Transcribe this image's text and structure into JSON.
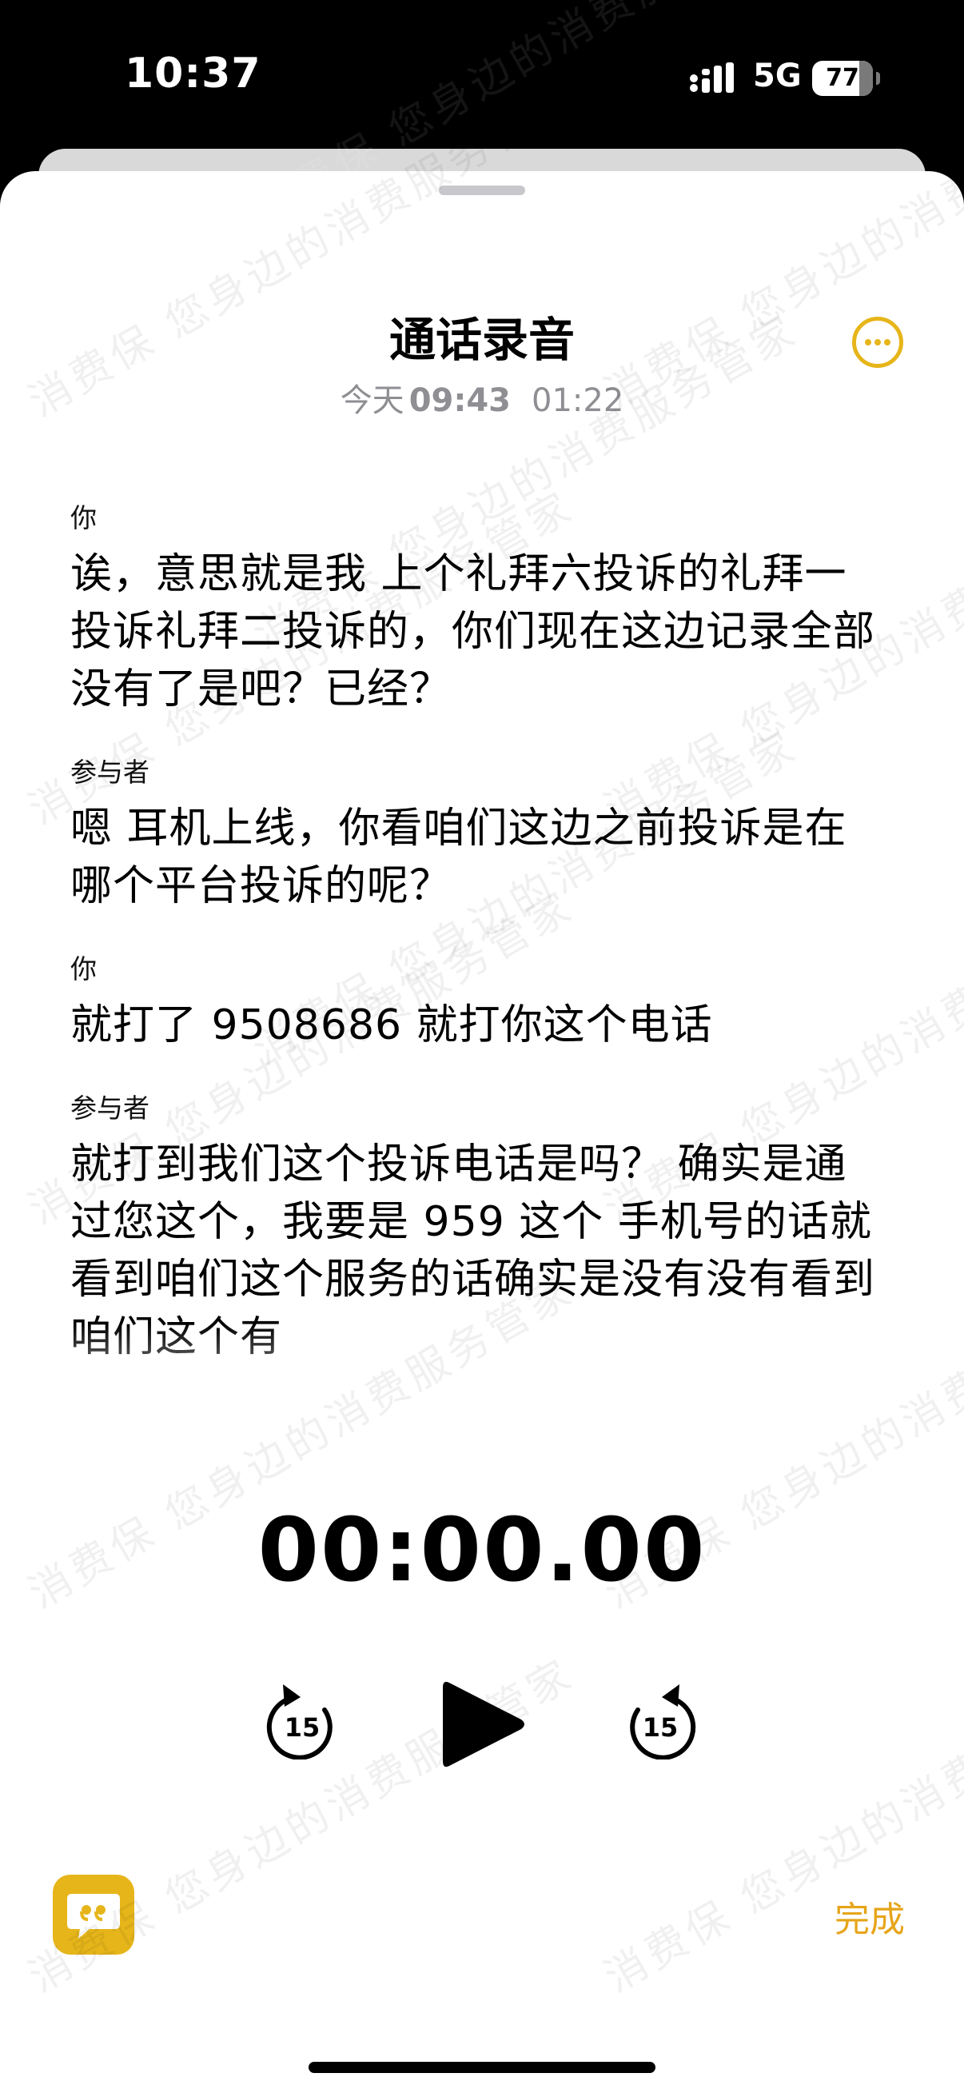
{
  "status_bar": {
    "time": "10:37",
    "network": "5G",
    "battery": "77",
    "battery_level": 0.77
  },
  "header": {
    "title": "通话录音",
    "date_day": "今天",
    "date_time": "09:43",
    "duration": "01:22",
    "more_icon": "ellipsis-circle-icon"
  },
  "transcript": [
    {
      "speaker": "你",
      "text": "诶，意思就是我 上个礼拜六投诉的礼拜一投诉礼拜二投诉的，你们现在这边记录全部没有了是吧？已经？"
    },
    {
      "speaker": "参与者",
      "text": "嗯 耳机上线，你看咱们这边之前投诉是在哪个平台投诉的呢？"
    },
    {
      "speaker": "你",
      "text": "就打了 9508686 就打你这个电话"
    },
    {
      "speaker": "参与者",
      "text": "就打到我们这个投诉电话是吗？ 确实是通过您这个，我要是 959 这个 手机号的话就看到咱们这个服务的话确实是没有没有看到咱们这个有"
    }
  ],
  "player": {
    "timer": "00:00.00",
    "skip_back_label": "15",
    "skip_forward_label": "15",
    "done_label": "完成",
    "accent_color": "#e6b51a"
  },
  "watermark": {
    "text": "消费保 您身边的消费服务管家"
  }
}
